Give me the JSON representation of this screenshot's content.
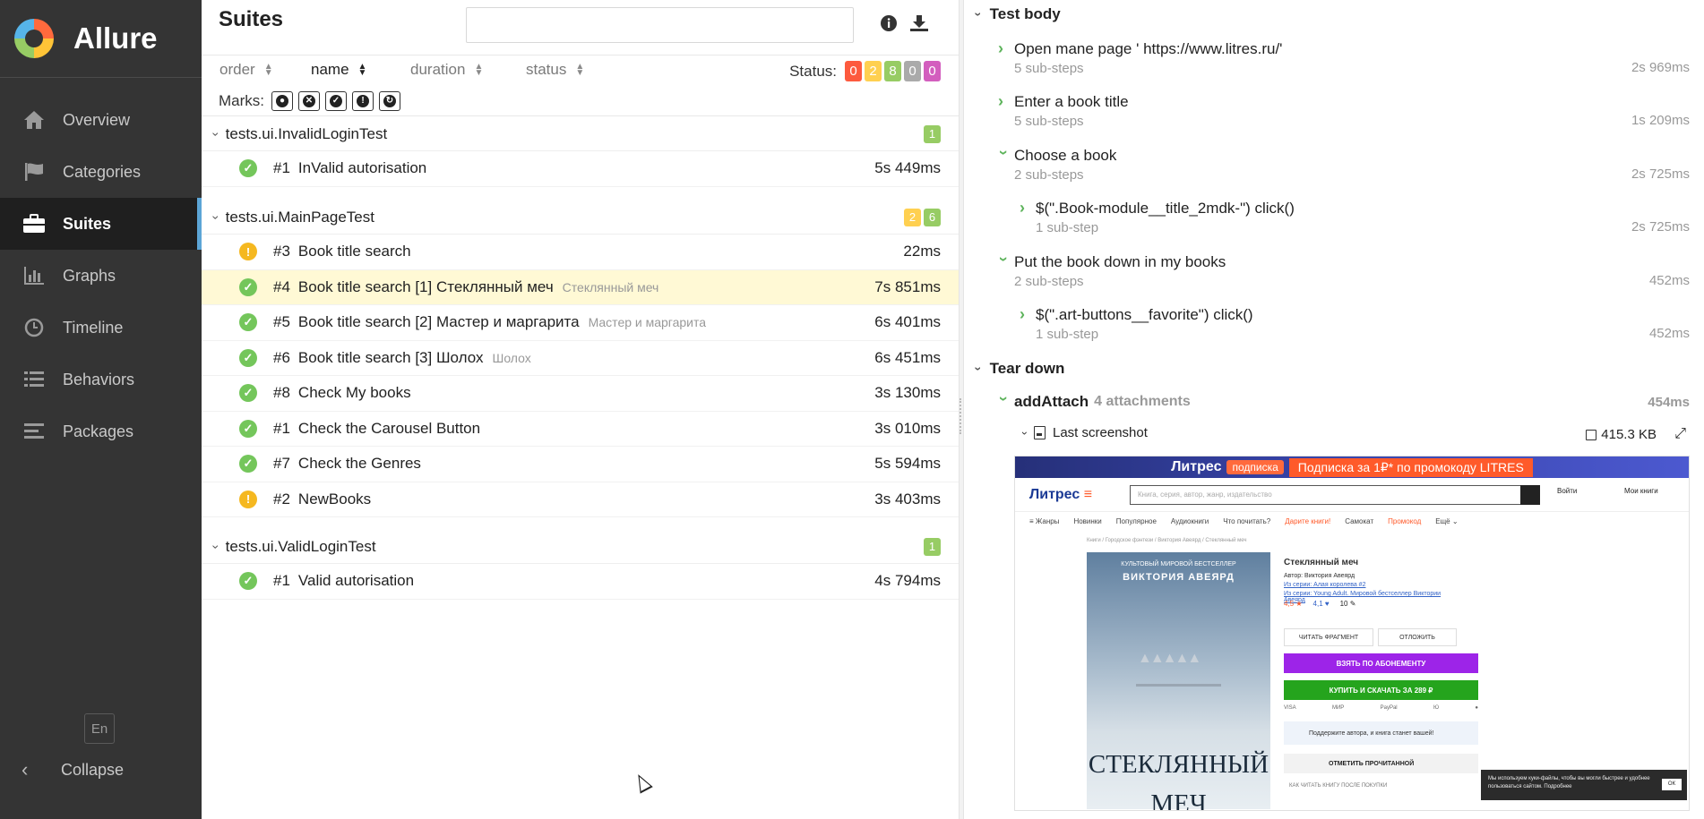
{
  "app": {
    "name": "Allure"
  },
  "sidebar": {
    "items": [
      {
        "label": "Overview",
        "icon": "home-icon"
      },
      {
        "label": "Categories",
        "icon": "flag-icon"
      },
      {
        "label": "Suites",
        "icon": "briefcase-icon",
        "active": true
      },
      {
        "label": "Graphs",
        "icon": "bar-chart-icon"
      },
      {
        "label": "Timeline",
        "icon": "clock-icon"
      },
      {
        "label": "Behaviors",
        "icon": "list-icon"
      },
      {
        "label": "Packages",
        "icon": "align-left-icon"
      }
    ],
    "language": "En",
    "collapse_label": "Collapse"
  },
  "middle": {
    "title": "Suites",
    "search_value": "",
    "sort": {
      "order": "order",
      "name": "name",
      "duration": "duration",
      "status": "status"
    },
    "status_label": "Status:",
    "status_counts": {
      "failed": "0",
      "broken": "2",
      "passed": "8",
      "skipped": "0",
      "unknown": "0"
    },
    "marks_label": "Marks:",
    "suites": [
      {
        "name": "tests.ui.InvalidLoginTest",
        "badges": [
          {
            "count": "1",
            "status": "passed"
          }
        ],
        "tests": [
          {
            "num": "#1",
            "name": "InValid autorisation",
            "param": "",
            "duration": "5s 449ms",
            "status": "passed"
          }
        ]
      },
      {
        "name": "tests.ui.MainPageTest",
        "badges": [
          {
            "count": "2",
            "status": "broken"
          },
          {
            "count": "6",
            "status": "passed"
          }
        ],
        "tests": [
          {
            "num": "#3",
            "name": "Book title search",
            "param": "",
            "duration": "22ms",
            "status": "broken"
          },
          {
            "num": "#4",
            "name": "Book title search [1] Стеклянный меч",
            "param": "Стеклянный меч",
            "duration": "7s 851ms",
            "status": "passed",
            "selected": true
          },
          {
            "num": "#5",
            "name": "Book title search [2] Мастер и маргарита",
            "param": "Мастер и маргарита",
            "duration": "6s 401ms",
            "status": "passed"
          },
          {
            "num": "#6",
            "name": "Book title search [3] Шолох",
            "param": "Шолох",
            "duration": "6s 451ms",
            "status": "passed"
          },
          {
            "num": "#8",
            "name": "Check My books",
            "param": "",
            "duration": "3s 130ms",
            "status": "passed"
          },
          {
            "num": "#1",
            "name": "Check the Carousel Button",
            "param": "",
            "duration": "3s 010ms",
            "status": "passed"
          },
          {
            "num": "#7",
            "name": "Check the Genres",
            "param": "",
            "duration": "5s 594ms",
            "status": "passed"
          },
          {
            "num": "#2",
            "name": "NewBooks",
            "param": "",
            "duration": "3s 403ms",
            "status": "broken"
          }
        ]
      },
      {
        "name": "tests.ui.ValidLoginTest",
        "badges": [
          {
            "count": "1",
            "status": "passed"
          }
        ],
        "tests": [
          {
            "num": "#1",
            "name": "Valid autorisation",
            "param": "",
            "duration": "4s 794ms",
            "status": "passed"
          }
        ]
      }
    ]
  },
  "right": {
    "test_body_label": "Test body",
    "steps": [
      {
        "title": "Open mane page ' https://www.litres.ru/'",
        "sub": "5 sub-steps",
        "duration": "2s 969ms"
      },
      {
        "title": "Enter a book title",
        "sub": "5 sub-steps",
        "duration": "1s 209ms"
      },
      {
        "title": "Choose a book",
        "sub": "2 sub-steps",
        "duration": "2s 725ms"
      },
      {
        "title": "$(\".Book-module__title_2mdk-\") click()",
        "sub": "1 sub-step",
        "duration": "2s 725ms"
      },
      {
        "title": "Put the book down in my books",
        "sub": "2 sub-steps",
        "duration": "452ms"
      },
      {
        "title": "$(\".art-buttons__favorite\") click()",
        "sub": "1 sub-step",
        "duration": "452ms"
      }
    ],
    "tear_down_label": "Tear down",
    "attach": {
      "name": "addAttach",
      "count": "4 attachments",
      "duration": "454ms"
    },
    "screenshot": {
      "label": "Last screenshot",
      "size": "415.3 KB"
    }
  },
  "preview": {
    "banner_brand": "Литрес",
    "banner_pill": "подписка",
    "banner_promo": "Подписка за 1₽* по промокоду LITRES",
    "logo": "Литрес",
    "search_placeholder": "Книга, серия, автор, жанр, издательство",
    "login": "Войти",
    "my_books": "Мои книги",
    "menu": [
      "≡ Жанры",
      "Новинки",
      "Популярное",
      "Аудиокниги",
      "Что почитать?",
      "Дарите книги!",
      "Самокат",
      "Промокод",
      "Ещё ⌄"
    ],
    "crumbs": "Книги / Городское фэнтези / Виктория Авеярд / Стеклянный меч",
    "cover_top": "КУЛЬТОВЫЙ МИРОВОЙ БЕСТСЕЛЛЕР",
    "cover_author": "ВИКТОРИЯ АВЕЯРД",
    "cover_title_1": "СТЕКЛЯННЫЙ",
    "cover_title_2": "МЕЧ",
    "book_title": "Стеклянный меч",
    "author_line": "Автор: Виктория Авеярд",
    "series_line_1": "Из серии: Алая королева #2",
    "series_line_2": "Из серии: Young Adult. Мировой бестселлер Виктории Авеярд",
    "rating_1": "4,5 ★",
    "rating_2": "4,1 ♥",
    "reviews": "10 ✎",
    "read_fragment": "ЧИТАТЬ ФРАГМЕНТ",
    "postpone": "ОТЛОЖИТЬ",
    "subscribe_btn": "ВЗЯТЬ ПО АБОНЕМЕНТУ",
    "buy_btn": "КУПИТЬ И СКАЧАТЬ ЗА 289 ₽",
    "pay_methods": [
      "VISA",
      "МИР",
      "PayPal",
      "Ю",
      "●"
    ],
    "support": "Поддержите автора, и книга станет вашей!",
    "mark_read": "ОТМЕТИТЬ ПРОЧИТАННОЙ",
    "howto": "КАК ЧИТАТЬ КНИГУ ПОСЛЕ ПОКУПКИ",
    "cookie_text": "Мы используем куки-файлы, чтобы вы могли быстрее и удобнее пользоваться сайтом. Подробнее",
    "cookie_ok": "ОК"
  },
  "colors": {
    "failed": "#fd5a3e",
    "broken": "#ffd050",
    "passed": "#97cc64",
    "skipped": "#aaaaaa",
    "unknown": "#d35ebe",
    "broken_icon": "#f5b820",
    "passed_icon": "#74c65b",
    "accent": "#5ca5d6"
  }
}
